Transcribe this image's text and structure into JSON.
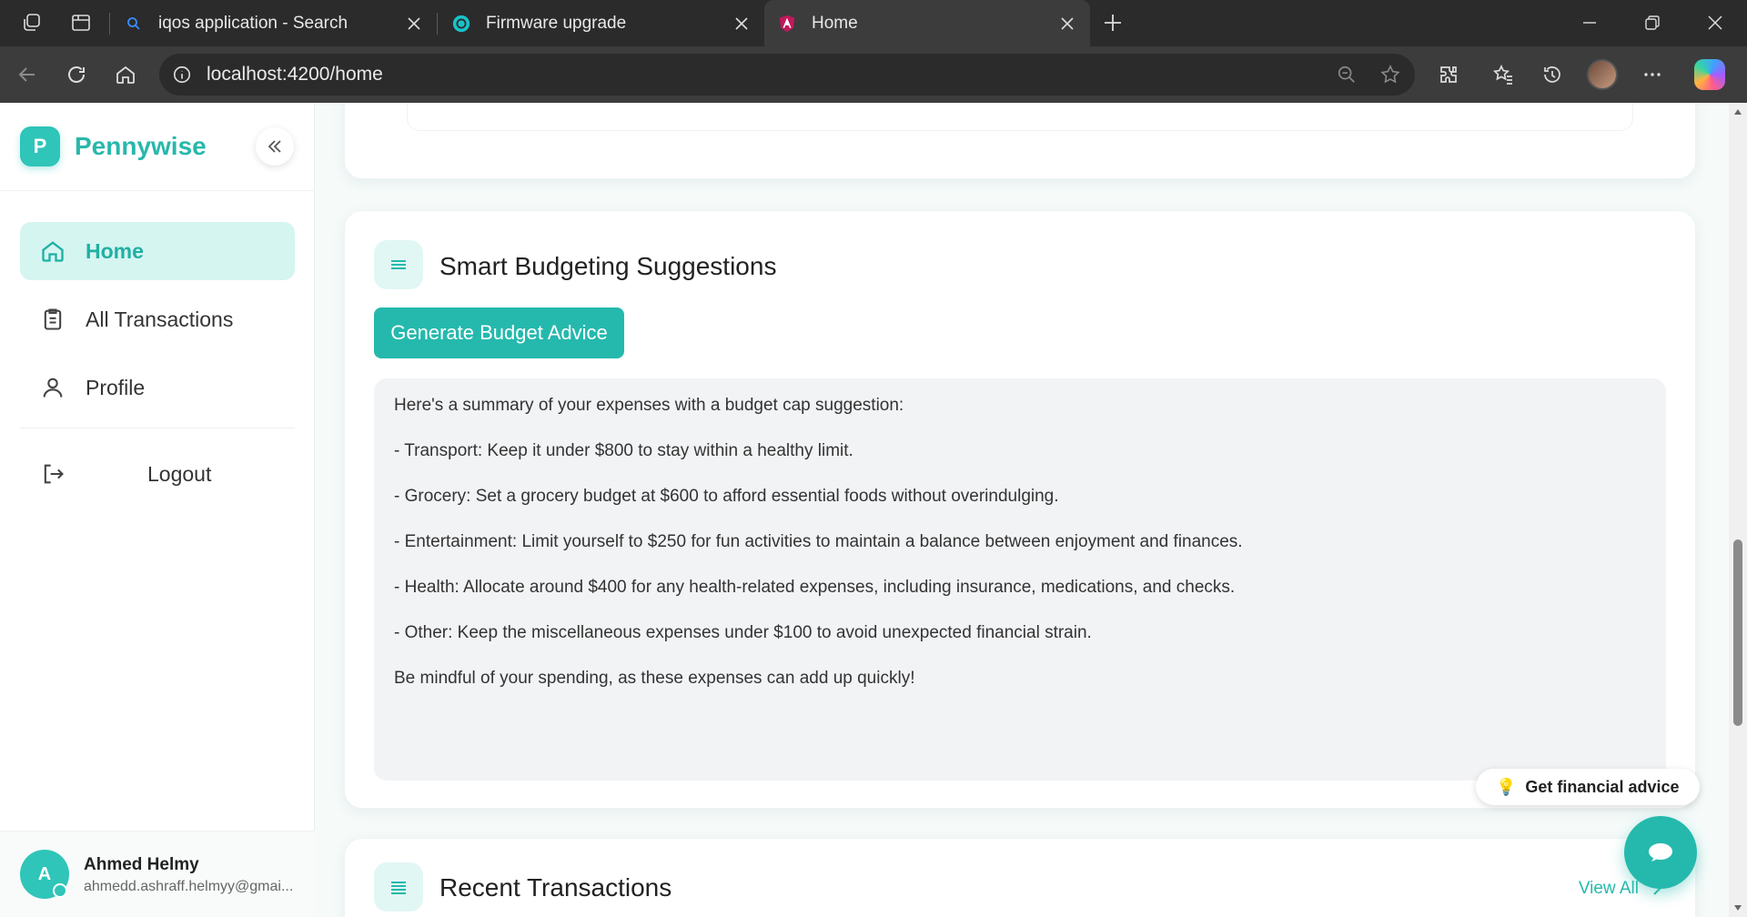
{
  "browser": {
    "tabs": [
      {
        "title": "iqos application - Search",
        "icon": "search-icon"
      },
      {
        "title": "Firmware upgrade",
        "icon": "globe-icon"
      },
      {
        "title": "Home",
        "icon": "angular-icon",
        "active": true
      }
    ],
    "url": "localhost:4200/home"
  },
  "sidebar": {
    "brand": {
      "logo_letter": "P",
      "name": "Pennywise"
    },
    "nav": [
      {
        "label": "Home",
        "icon": "home-icon",
        "active": true
      },
      {
        "label": "All Transactions",
        "icon": "clipboard-icon"
      },
      {
        "label": "Profile",
        "icon": "user-icon"
      }
    ],
    "logout_label": "Logout",
    "user": {
      "initial": "A",
      "name": "Ahmed Helmy",
      "email": "ahmedd.ashraff.helmyy@gmai..."
    }
  },
  "budget": {
    "title": "Smart Budgeting Suggestions",
    "button_label": "Generate Budget Advice",
    "advice_lines": [
      "Here's a summary of your expenses with a budget cap suggestion:",
      "- Transport: Keep it under $800 to stay within a healthy limit.",
      "- Grocery: Set a grocery budget at $600 to afford essential foods without overindulging.",
      "- Entertainment: Limit yourself to $250 for fun activities to maintain a balance between enjoyment and finances.",
      "- Health: Allocate around $400 for any health-related expenses, including insurance, medications, and checks.",
      "- Other: Keep the miscellaneous expenses under $100 to avoid unexpected financial strain.",
      "Be mindful of your spending, as these expenses can add up quickly!"
    ]
  },
  "financial_advice_label": "Get financial advice",
  "recent": {
    "title": "Recent Transactions",
    "view_all": "View All"
  },
  "colors": {
    "accent": "#25b9ad",
    "accent_light": "#d5f5f1"
  }
}
